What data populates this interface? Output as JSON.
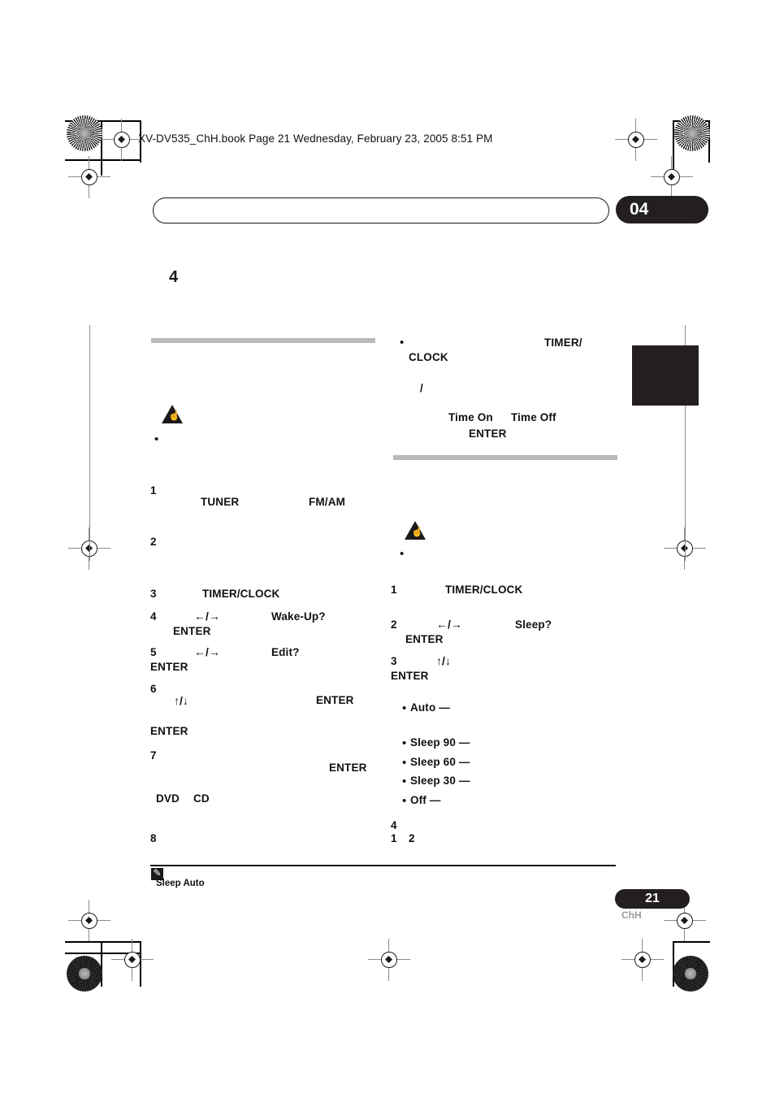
{
  "header": {
    "file_line": "XV-DV535_ChH.book  Page 21  Wednesday, February 23, 2005  8:51 PM"
  },
  "chapter": {
    "badge_number": "04",
    "section_number": "4"
  },
  "page_footer": {
    "page_number": "21",
    "language_code": "ChH"
  },
  "footnote": {
    "text": "Sleep Auto"
  },
  "left_column": {
    "steps": [
      {
        "num": "1",
        "keywords": [
          "TUNER",
          "FM/AM"
        ]
      },
      {
        "num": "2",
        "keywords": []
      },
      {
        "num": "3",
        "keywords": [
          "TIMER/CLOCK"
        ]
      },
      {
        "num": "4",
        "keywords": [
          "Wake-Up?",
          "ENTER"
        ],
        "arrows": "←/→"
      },
      {
        "num": "5",
        "keywords": [
          "Edit?",
          "ENTER"
        ],
        "arrows": "←/→"
      },
      {
        "num": "6",
        "keywords": [
          "ENTER",
          "ENTER"
        ],
        "arrows": "↑/↓"
      },
      {
        "num": "7",
        "keywords": [
          "ENTER",
          "DVD",
          "CD"
        ]
      },
      {
        "num": "8",
        "keywords": []
      }
    ],
    "labels": {
      "tuner": "TUNER",
      "fm_am": "FM/AM",
      "timer_clock": "TIMER/CLOCK",
      "wake_up": "Wake-Up?",
      "enter": "ENTER",
      "edit": "Edit?",
      "dvd": "DVD",
      "cd": "CD",
      "arrows_lr": "←/→",
      "arrows_ud": "↑/↓"
    }
  },
  "right_column": {
    "note_bullet": {
      "timer_clock": "TIMER/",
      "timer_clock_2": "CLOCK",
      "slash": "/",
      "time_on": "Time On",
      "time_off": "Time Off",
      "enter": "ENTER"
    },
    "steps": [
      {
        "num": "1",
        "keywords": [
          "TIMER/CLOCK"
        ]
      },
      {
        "num": "2",
        "keywords": [
          "Sleep?",
          "ENTER"
        ],
        "arrows": "←/→"
      },
      {
        "num": "3",
        "keywords": [
          "ENTER"
        ],
        "arrows": "↑/↓"
      },
      {
        "num": "4",
        "keywords": []
      }
    ],
    "sleep_options": [
      "Auto —",
      "Sleep 90 —",
      "Sleep 60 —",
      "Sleep 30 —",
      "Off —"
    ],
    "ref_numbers": [
      "1",
      "2"
    ],
    "labels": {
      "timer_clock": "TIMER/CLOCK",
      "sleep": "Sleep?",
      "enter": "ENTER",
      "arrows_lr": "←/→",
      "arrows_ud": "↑/↓"
    }
  },
  "icons": {
    "warning_hand": "☝",
    "note_pen": "✎"
  },
  "colors": {
    "badge_black": "#231f20",
    "gray_rule": "#b9b9b9",
    "text": "#1a1a1a",
    "page_lang_gray": "#9a9a9a"
  }
}
